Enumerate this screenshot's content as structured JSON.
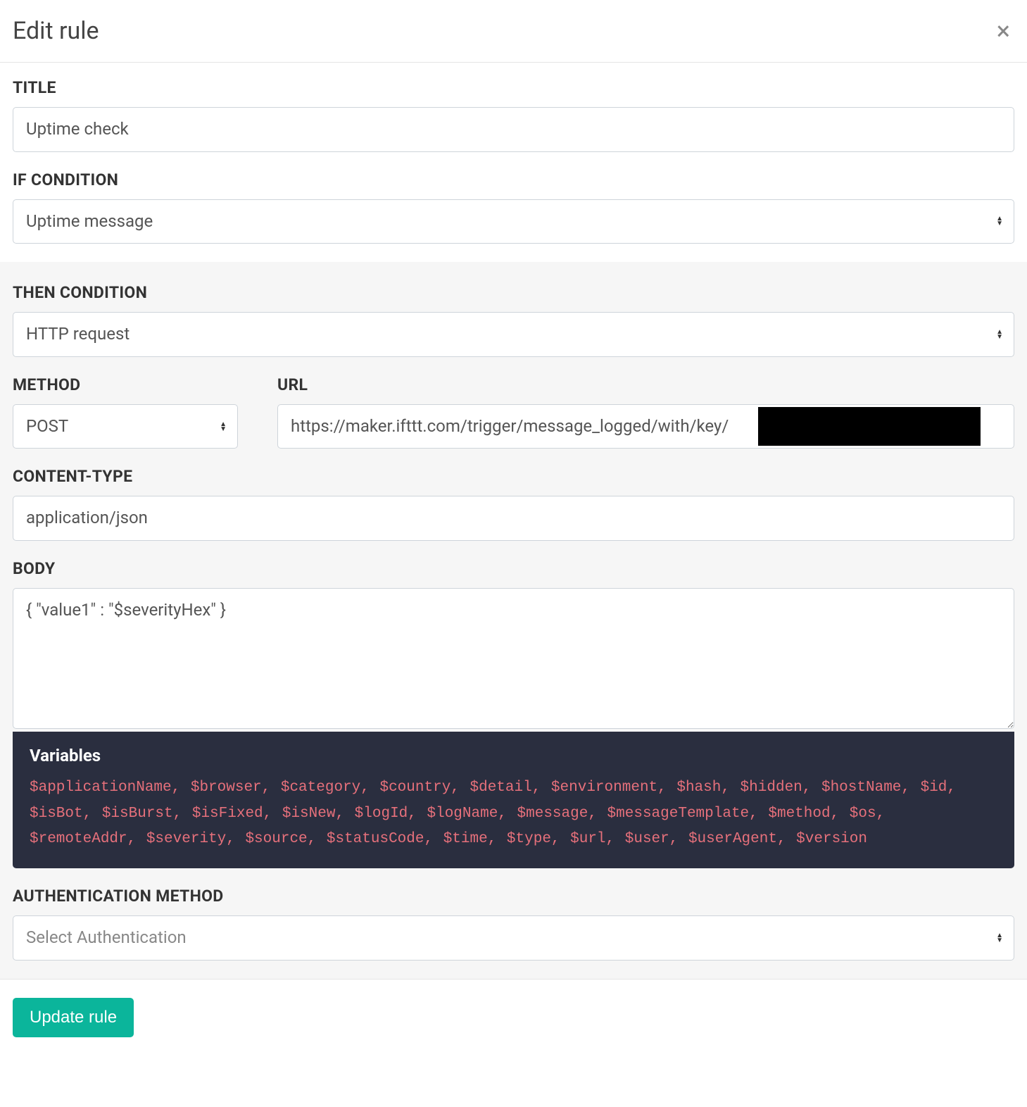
{
  "header": {
    "title": "Edit rule"
  },
  "section_if": {
    "title_label": "TITLE",
    "title_value": "Uptime check",
    "condition_label": "IF CONDITION",
    "condition_value": "Uptime message"
  },
  "section_then": {
    "condition_label": "THEN CONDITION",
    "condition_value": "HTTP request",
    "method_label": "METHOD",
    "method_value": "POST",
    "url_label": "URL",
    "url_value": "https://maker.ifttt.com/trigger/message_logged/with/key/",
    "content_type_label": "CONTENT-TYPE",
    "content_type_value": "application/json",
    "body_label": "BODY",
    "body_value": "{ \"value1\" : \"$severityHex\" }",
    "variables_title": "Variables",
    "variables": [
      "$applicationName",
      "$browser",
      "$category",
      "$country",
      "$detail",
      "$environment",
      "$hash",
      "$hidden",
      "$hostName",
      "$id",
      "$isBot",
      "$isBurst",
      "$isFixed",
      "$isNew",
      "$logId",
      "$logName",
      "$message",
      "$messageTemplate",
      "$method",
      "$os",
      "$remoteAddr",
      "$severity",
      "$source",
      "$statusCode",
      "$time",
      "$type",
      "$url",
      "$user",
      "$userAgent",
      "$version"
    ],
    "auth_label": "AUTHENTICATION METHOD",
    "auth_value": "Select Authentication"
  },
  "footer": {
    "submit_label": "Update rule"
  }
}
